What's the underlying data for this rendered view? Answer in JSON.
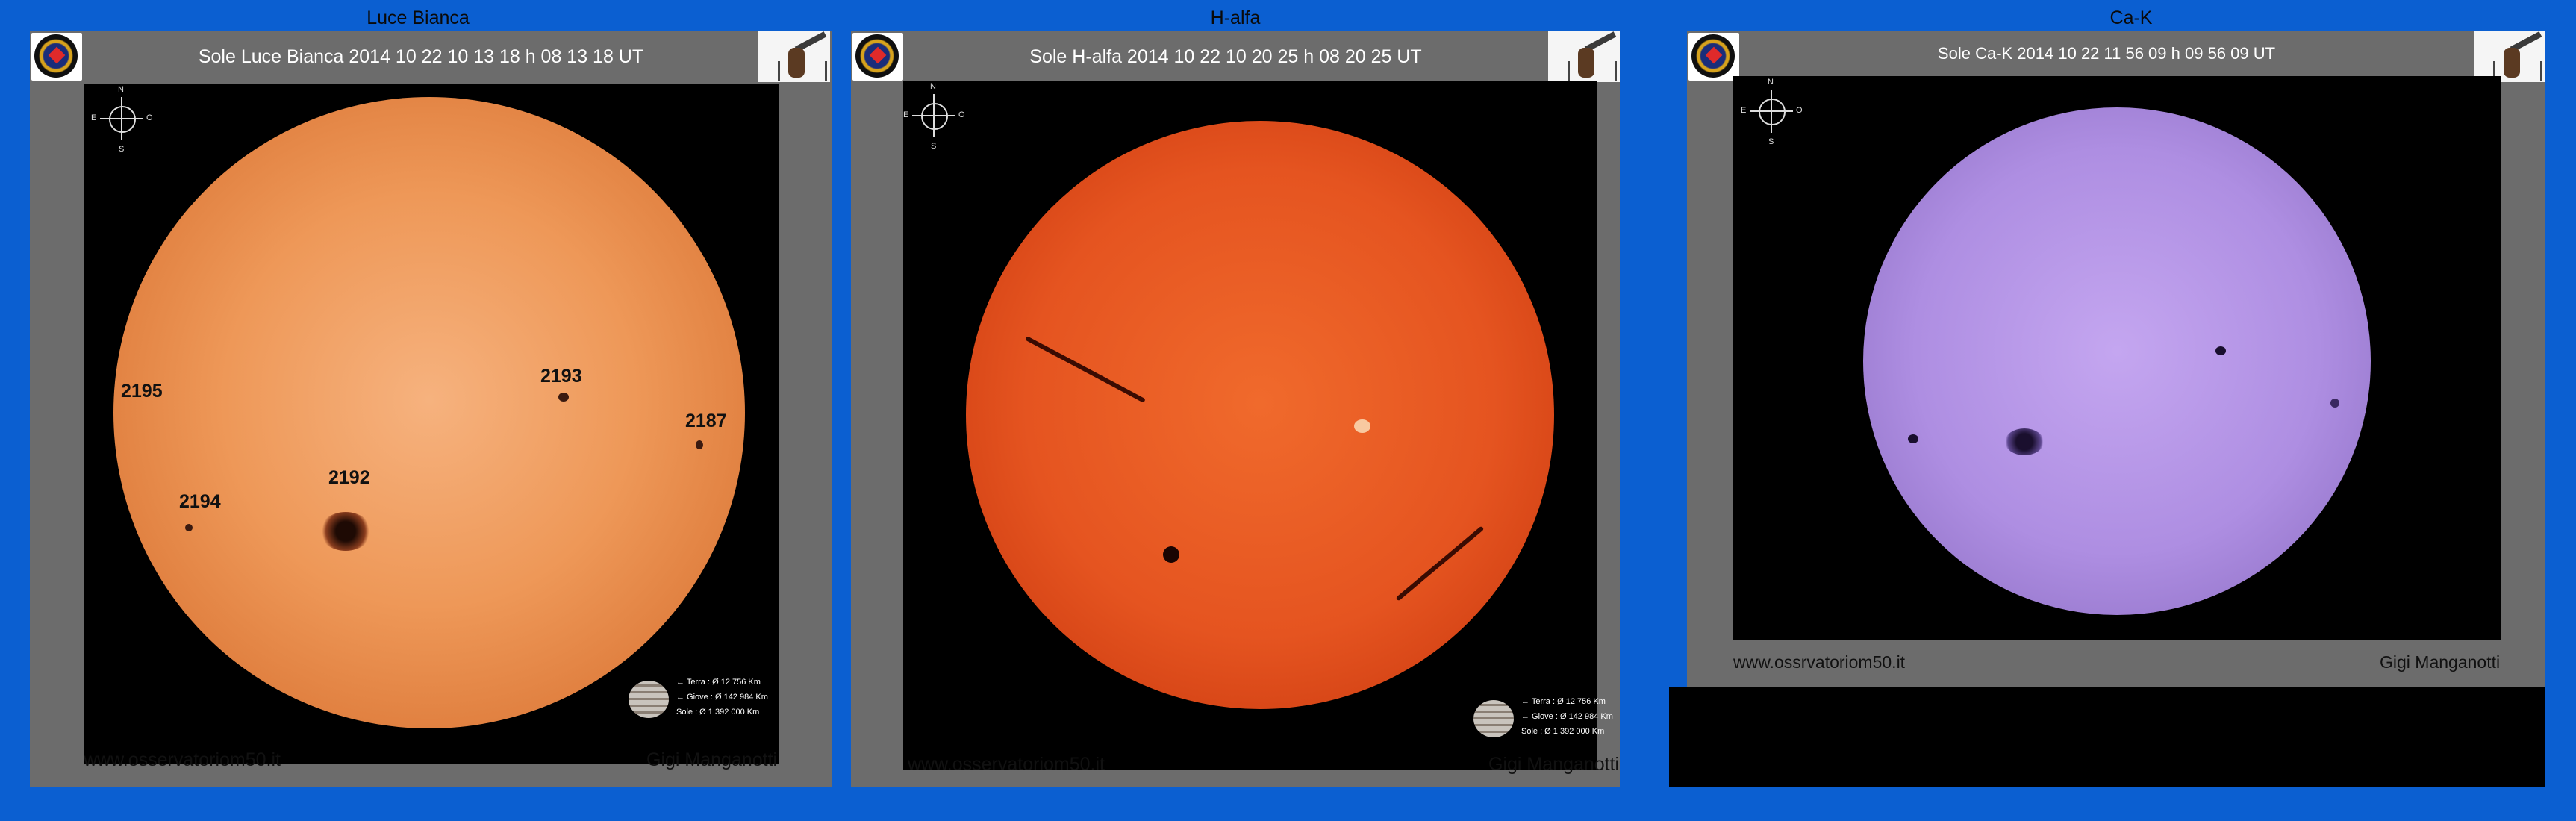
{
  "panels": [
    {
      "title": "Luce Bianca",
      "header": "Sole Luce Bianca 2014 10 22 10 13 18 h 08 13 18 UT",
      "compass": {
        "n": "N",
        "s": "S",
        "e": "E",
        "o": "O"
      },
      "regions": [
        "2195",
        "2193",
        "2187",
        "2194",
        "2192"
      ],
      "scale": {
        "terra": "← Terra : Ø 12 756 Km",
        "giove": "← Giove : Ø 142 984 Km",
        "sole": "Sole : Ø  1 392 000 Km"
      },
      "footer_left": "www.osservatoriom50.it",
      "footer_right": "Gigi Manganotti"
    },
    {
      "title": "H-alfa",
      "header": "Sole H-alfa 2014 10 22 10 20 25 h 08 20 25 UT",
      "compass": {
        "n": "N",
        "s": "S",
        "e": "E",
        "o": "O"
      },
      "scale": {
        "terra": "← Terra : Ø 12 756 Km",
        "giove": "← Giove : Ø 142 984 Km",
        "sole": "Sole : Ø  1 392 000 Km"
      },
      "footer_left": "www.osservatoriom50.it",
      "footer_right": "Gigi Manganotti"
    },
    {
      "title": "Ca-K",
      "header": "Sole Ca-K 2014 10 22 11 56 09 h 09 56 09 UT",
      "compass": {
        "n": "N",
        "s": "S",
        "e": "E",
        "o": "O"
      },
      "footer_left": "www.ossrvatoriom50.it",
      "footer_right": "Gigi Manganotti"
    }
  ],
  "colors": {
    "background": "#0b5fd1",
    "frame": "#6c6c6c",
    "white_light_sun": "#e88a4c",
    "halpha_sun": "#e2531b",
    "cak_sun": "#a98bdc"
  }
}
